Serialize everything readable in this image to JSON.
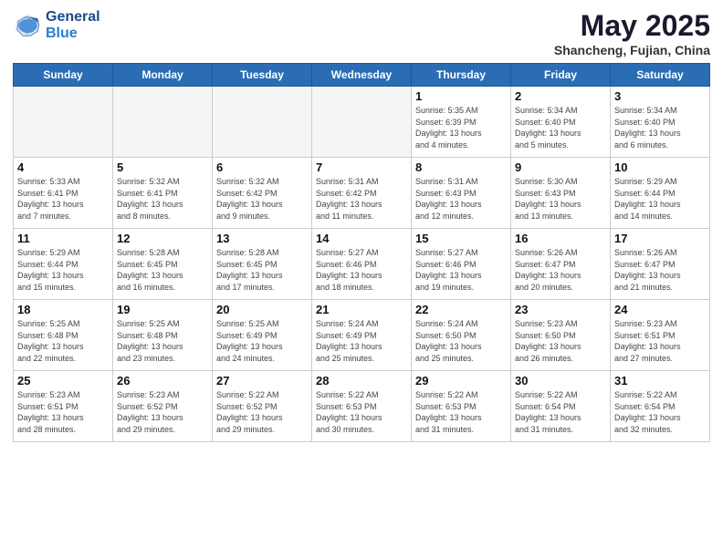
{
  "header": {
    "logo_line1": "General",
    "logo_line2": "Blue",
    "month_year": "May 2025",
    "location": "Shancheng, Fujian, China"
  },
  "weekdays": [
    "Sunday",
    "Monday",
    "Tuesday",
    "Wednesday",
    "Thursday",
    "Friday",
    "Saturday"
  ],
  "days": [
    {
      "num": "",
      "info": "",
      "empty": true
    },
    {
      "num": "",
      "info": "",
      "empty": true
    },
    {
      "num": "",
      "info": "",
      "empty": true
    },
    {
      "num": "",
      "info": "",
      "empty": true
    },
    {
      "num": "1",
      "info": "Sunrise: 5:35 AM\nSunset: 6:39 PM\nDaylight: 13 hours\nand 4 minutes."
    },
    {
      "num": "2",
      "info": "Sunrise: 5:34 AM\nSunset: 6:40 PM\nDaylight: 13 hours\nand 5 minutes."
    },
    {
      "num": "3",
      "info": "Sunrise: 5:34 AM\nSunset: 6:40 PM\nDaylight: 13 hours\nand 6 minutes."
    },
    {
      "num": "4",
      "info": "Sunrise: 5:33 AM\nSunset: 6:41 PM\nDaylight: 13 hours\nand 7 minutes."
    },
    {
      "num": "5",
      "info": "Sunrise: 5:32 AM\nSunset: 6:41 PM\nDaylight: 13 hours\nand 8 minutes."
    },
    {
      "num": "6",
      "info": "Sunrise: 5:32 AM\nSunset: 6:42 PM\nDaylight: 13 hours\nand 9 minutes."
    },
    {
      "num": "7",
      "info": "Sunrise: 5:31 AM\nSunset: 6:42 PM\nDaylight: 13 hours\nand 11 minutes."
    },
    {
      "num": "8",
      "info": "Sunrise: 5:31 AM\nSunset: 6:43 PM\nDaylight: 13 hours\nand 12 minutes."
    },
    {
      "num": "9",
      "info": "Sunrise: 5:30 AM\nSunset: 6:43 PM\nDaylight: 13 hours\nand 13 minutes."
    },
    {
      "num": "10",
      "info": "Sunrise: 5:29 AM\nSunset: 6:44 PM\nDaylight: 13 hours\nand 14 minutes."
    },
    {
      "num": "11",
      "info": "Sunrise: 5:29 AM\nSunset: 6:44 PM\nDaylight: 13 hours\nand 15 minutes."
    },
    {
      "num": "12",
      "info": "Sunrise: 5:28 AM\nSunset: 6:45 PM\nDaylight: 13 hours\nand 16 minutes."
    },
    {
      "num": "13",
      "info": "Sunrise: 5:28 AM\nSunset: 6:45 PM\nDaylight: 13 hours\nand 17 minutes."
    },
    {
      "num": "14",
      "info": "Sunrise: 5:27 AM\nSunset: 6:46 PM\nDaylight: 13 hours\nand 18 minutes."
    },
    {
      "num": "15",
      "info": "Sunrise: 5:27 AM\nSunset: 6:46 PM\nDaylight: 13 hours\nand 19 minutes."
    },
    {
      "num": "16",
      "info": "Sunrise: 5:26 AM\nSunset: 6:47 PM\nDaylight: 13 hours\nand 20 minutes."
    },
    {
      "num": "17",
      "info": "Sunrise: 5:26 AM\nSunset: 6:47 PM\nDaylight: 13 hours\nand 21 minutes."
    },
    {
      "num": "18",
      "info": "Sunrise: 5:25 AM\nSunset: 6:48 PM\nDaylight: 13 hours\nand 22 minutes."
    },
    {
      "num": "19",
      "info": "Sunrise: 5:25 AM\nSunset: 6:48 PM\nDaylight: 13 hours\nand 23 minutes."
    },
    {
      "num": "20",
      "info": "Sunrise: 5:25 AM\nSunset: 6:49 PM\nDaylight: 13 hours\nand 24 minutes."
    },
    {
      "num": "21",
      "info": "Sunrise: 5:24 AM\nSunset: 6:49 PM\nDaylight: 13 hours\nand 25 minutes."
    },
    {
      "num": "22",
      "info": "Sunrise: 5:24 AM\nSunset: 6:50 PM\nDaylight: 13 hours\nand 25 minutes."
    },
    {
      "num": "23",
      "info": "Sunrise: 5:23 AM\nSunset: 6:50 PM\nDaylight: 13 hours\nand 26 minutes."
    },
    {
      "num": "24",
      "info": "Sunrise: 5:23 AM\nSunset: 6:51 PM\nDaylight: 13 hours\nand 27 minutes."
    },
    {
      "num": "25",
      "info": "Sunrise: 5:23 AM\nSunset: 6:51 PM\nDaylight: 13 hours\nand 28 minutes."
    },
    {
      "num": "26",
      "info": "Sunrise: 5:23 AM\nSunset: 6:52 PM\nDaylight: 13 hours\nand 29 minutes."
    },
    {
      "num": "27",
      "info": "Sunrise: 5:22 AM\nSunset: 6:52 PM\nDaylight: 13 hours\nand 29 minutes."
    },
    {
      "num": "28",
      "info": "Sunrise: 5:22 AM\nSunset: 6:53 PM\nDaylight: 13 hours\nand 30 minutes."
    },
    {
      "num": "29",
      "info": "Sunrise: 5:22 AM\nSunset: 6:53 PM\nDaylight: 13 hours\nand 31 minutes."
    },
    {
      "num": "30",
      "info": "Sunrise: 5:22 AM\nSunset: 6:54 PM\nDaylight: 13 hours\nand 31 minutes."
    },
    {
      "num": "31",
      "info": "Sunrise: 5:22 AM\nSunset: 6:54 PM\nDaylight: 13 hours\nand 32 minutes."
    }
  ]
}
